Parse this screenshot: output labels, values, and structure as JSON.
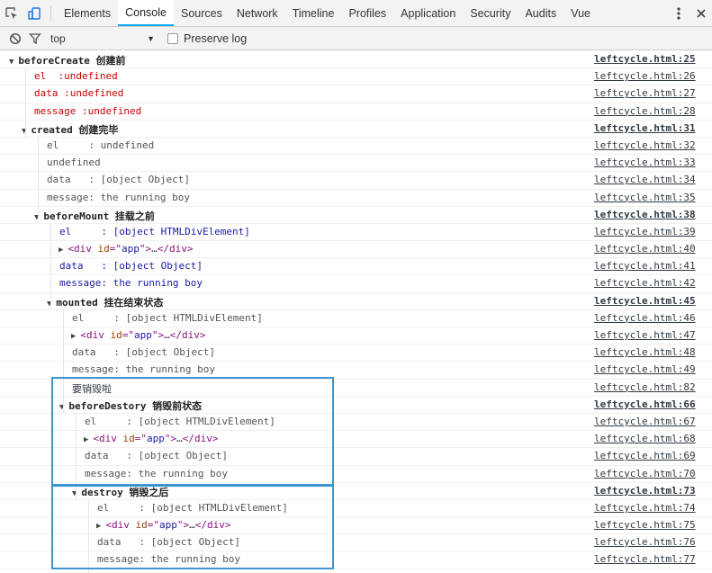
{
  "toolbar": {
    "tabs": [
      "Elements",
      "Console",
      "Sources",
      "Network",
      "Timeline",
      "Profiles",
      "Application",
      "Security",
      "Audits",
      "Vue"
    ],
    "active_tab": "Console",
    "icons": [
      "inspect-icon",
      "device-mode-icon",
      "more-icon",
      "close-icon"
    ]
  },
  "filter": {
    "context": "top",
    "preserve_label": "Preserve log",
    "preserve_checked": false
  },
  "colors": {
    "accent": "#03a9f4",
    "highlight": "#3d95ce",
    "error_text": "#c80000",
    "value_blue": "#1a1aa6"
  },
  "log": [
    {
      "indent": 0,
      "group": true,
      "text": "beforeCreate 创建前",
      "src": "leftcycle.html:25"
    },
    {
      "indent": 1,
      "style": "red",
      "text": "el  :undefined",
      "src": "leftcycle.html:26"
    },
    {
      "indent": 1,
      "style": "red",
      "text": "data :undefined",
      "src": "leftcycle.html:27"
    },
    {
      "indent": 1,
      "style": "red",
      "text": "message :undefined",
      "src": "leftcycle.html:28"
    },
    {
      "indent": 1,
      "group": true,
      "text": "created 创建完毕",
      "src": "leftcycle.html:31"
    },
    {
      "indent": 2,
      "style": "gray",
      "text": "el     : undefined",
      "src": "leftcycle.html:32"
    },
    {
      "indent": 2,
      "style": "gray",
      "text": "undefined",
      "src": "leftcycle.html:33"
    },
    {
      "indent": 2,
      "style": "gray",
      "text": "data   : [object Object]",
      "src": "leftcycle.html:34"
    },
    {
      "indent": 2,
      "style": "gray",
      "text": "message: the running boy",
      "src": "leftcycle.html:35"
    },
    {
      "indent": 2,
      "group": true,
      "text": "beforeMount 挂载之前",
      "src": "leftcycle.html:38"
    },
    {
      "indent": 3,
      "style": "blue",
      "text": "el     : [object HTMLDivElement]",
      "src": "leftcycle.html:39"
    },
    {
      "indent": 3,
      "node": true,
      "text": "<div id=\"app\">…</div>",
      "src": "leftcycle.html:40"
    },
    {
      "indent": 3,
      "style": "blue",
      "text": "data   : [object Object]",
      "src": "leftcycle.html:41"
    },
    {
      "indent": 3,
      "style": "blue",
      "text": "message: the running boy",
      "src": "leftcycle.html:42"
    },
    {
      "indent": 3,
      "group": true,
      "text": "mounted 挂在结束状态",
      "src": "leftcycle.html:45"
    },
    {
      "indent": 4,
      "style": "gray",
      "text": "el     : [object HTMLDivElement]",
      "src": "leftcycle.html:46"
    },
    {
      "indent": 4,
      "node": true,
      "text": "<div id=\"app\">…</div>",
      "src": "leftcycle.html:47"
    },
    {
      "indent": 4,
      "style": "gray",
      "text": "data   : [object Object]",
      "src": "leftcycle.html:48"
    },
    {
      "indent": 4,
      "style": "gray",
      "text": "message: the running boy",
      "src": "leftcycle.html:49"
    },
    {
      "indent": 4,
      "style": "plain",
      "text": "要销毁啦",
      "src": "leftcycle.html:82"
    },
    {
      "indent": 4,
      "group": true,
      "text": "beforeDestory 销毁前状态",
      "src": "leftcycle.html:66"
    },
    {
      "indent": 5,
      "style": "gray",
      "text": "el     : [object HTMLDivElement]",
      "src": "leftcycle.html:67"
    },
    {
      "indent": 5,
      "node": true,
      "text": "<div id=\"app\">…</div>",
      "src": "leftcycle.html:68"
    },
    {
      "indent": 5,
      "style": "gray",
      "text": "data   : [object Object]",
      "src": "leftcycle.html:69"
    },
    {
      "indent": 5,
      "style": "gray",
      "text": "message: the running boy",
      "src": "leftcycle.html:70"
    },
    {
      "indent": 5,
      "group": true,
      "text": "destroy 销毁之后",
      "src": "leftcycle.html:73"
    },
    {
      "indent": 6,
      "style": "gray",
      "text": "el     : [object HTMLDivElement]",
      "src": "leftcycle.html:74"
    },
    {
      "indent": 6,
      "node": true,
      "text": "<div id=\"app\">…</div>",
      "src": "leftcycle.html:75"
    },
    {
      "indent": 6,
      "style": "gray",
      "text": "data   : [object Object]",
      "src": "leftcycle.html:76"
    },
    {
      "indent": 6,
      "style": "gray",
      "text": "message: the running boy",
      "src": "leftcycle.html:77"
    }
  ]
}
